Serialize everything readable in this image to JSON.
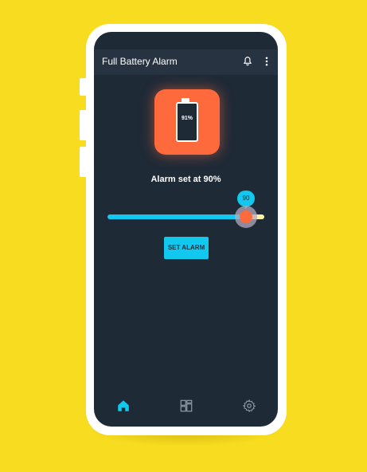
{
  "app": {
    "title": "Full Battery Alarm",
    "icon_battery_text": "91%"
  },
  "alarm": {
    "label": "Alarm set at 90%",
    "slider_value": 90,
    "slider_bubble": "90"
  },
  "buttons": {
    "set_alarm": "SET ALARM"
  },
  "bottom_nav": {
    "items": [
      "home-icon",
      "dashboard-icon",
      "settings-icon"
    ],
    "active_index": 0
  },
  "colors": {
    "background": "#f7dc1f",
    "screen": "#1f2a37",
    "accent": "#11c9ee",
    "icon_orange": "#ff6a3d"
  }
}
